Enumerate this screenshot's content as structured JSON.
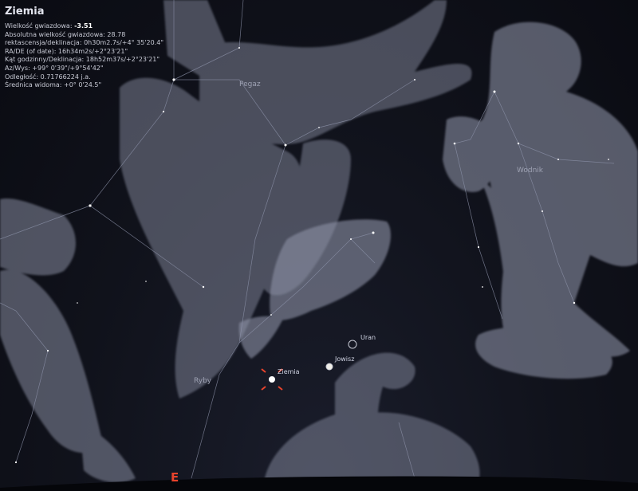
{
  "object": {
    "name": "Ziemia",
    "rows": [
      {
        "label": "Wielkość gwiazdowa: ",
        "value": "-3.51"
      },
      {
        "label": "Absolutna wielkość gwiazdowa: 28.78",
        "value": ""
      },
      {
        "label": "rektascensja/deklinacja: 0h30m2.7s/+4° 35'20.4\"",
        "value": ""
      },
      {
        "label": "RA/DE (of date): 16h34m2s/+2°23'21\"",
        "value": ""
      },
      {
        "label": "Kąt godzinny/Deklinacja: 18h52m37s/+2°23'21\"",
        "value": ""
      },
      {
        "label": "Az/Wys: +99° 0'39\"/+9°54'42\"",
        "value": ""
      },
      {
        "label": "Odległość: 0.71766224 j.a.",
        "value": ""
      },
      {
        "label": "Średnica widoma: +0° 0'24.5\"",
        "value": ""
      }
    ]
  },
  "constellations": {
    "pegaz": "Pegaz",
    "wodnik": "Wodnik",
    "ryby": "Ryby"
  },
  "planets": {
    "ziemia": "Ziemia",
    "jowisz": "Jowisz",
    "uran": "Uran"
  },
  "compass": {
    "east": "E"
  },
  "colors": {
    "sky": "#10121b",
    "art": "#9aa0b4",
    "lines": "#8d93aa",
    "selection": "#e8432c"
  }
}
